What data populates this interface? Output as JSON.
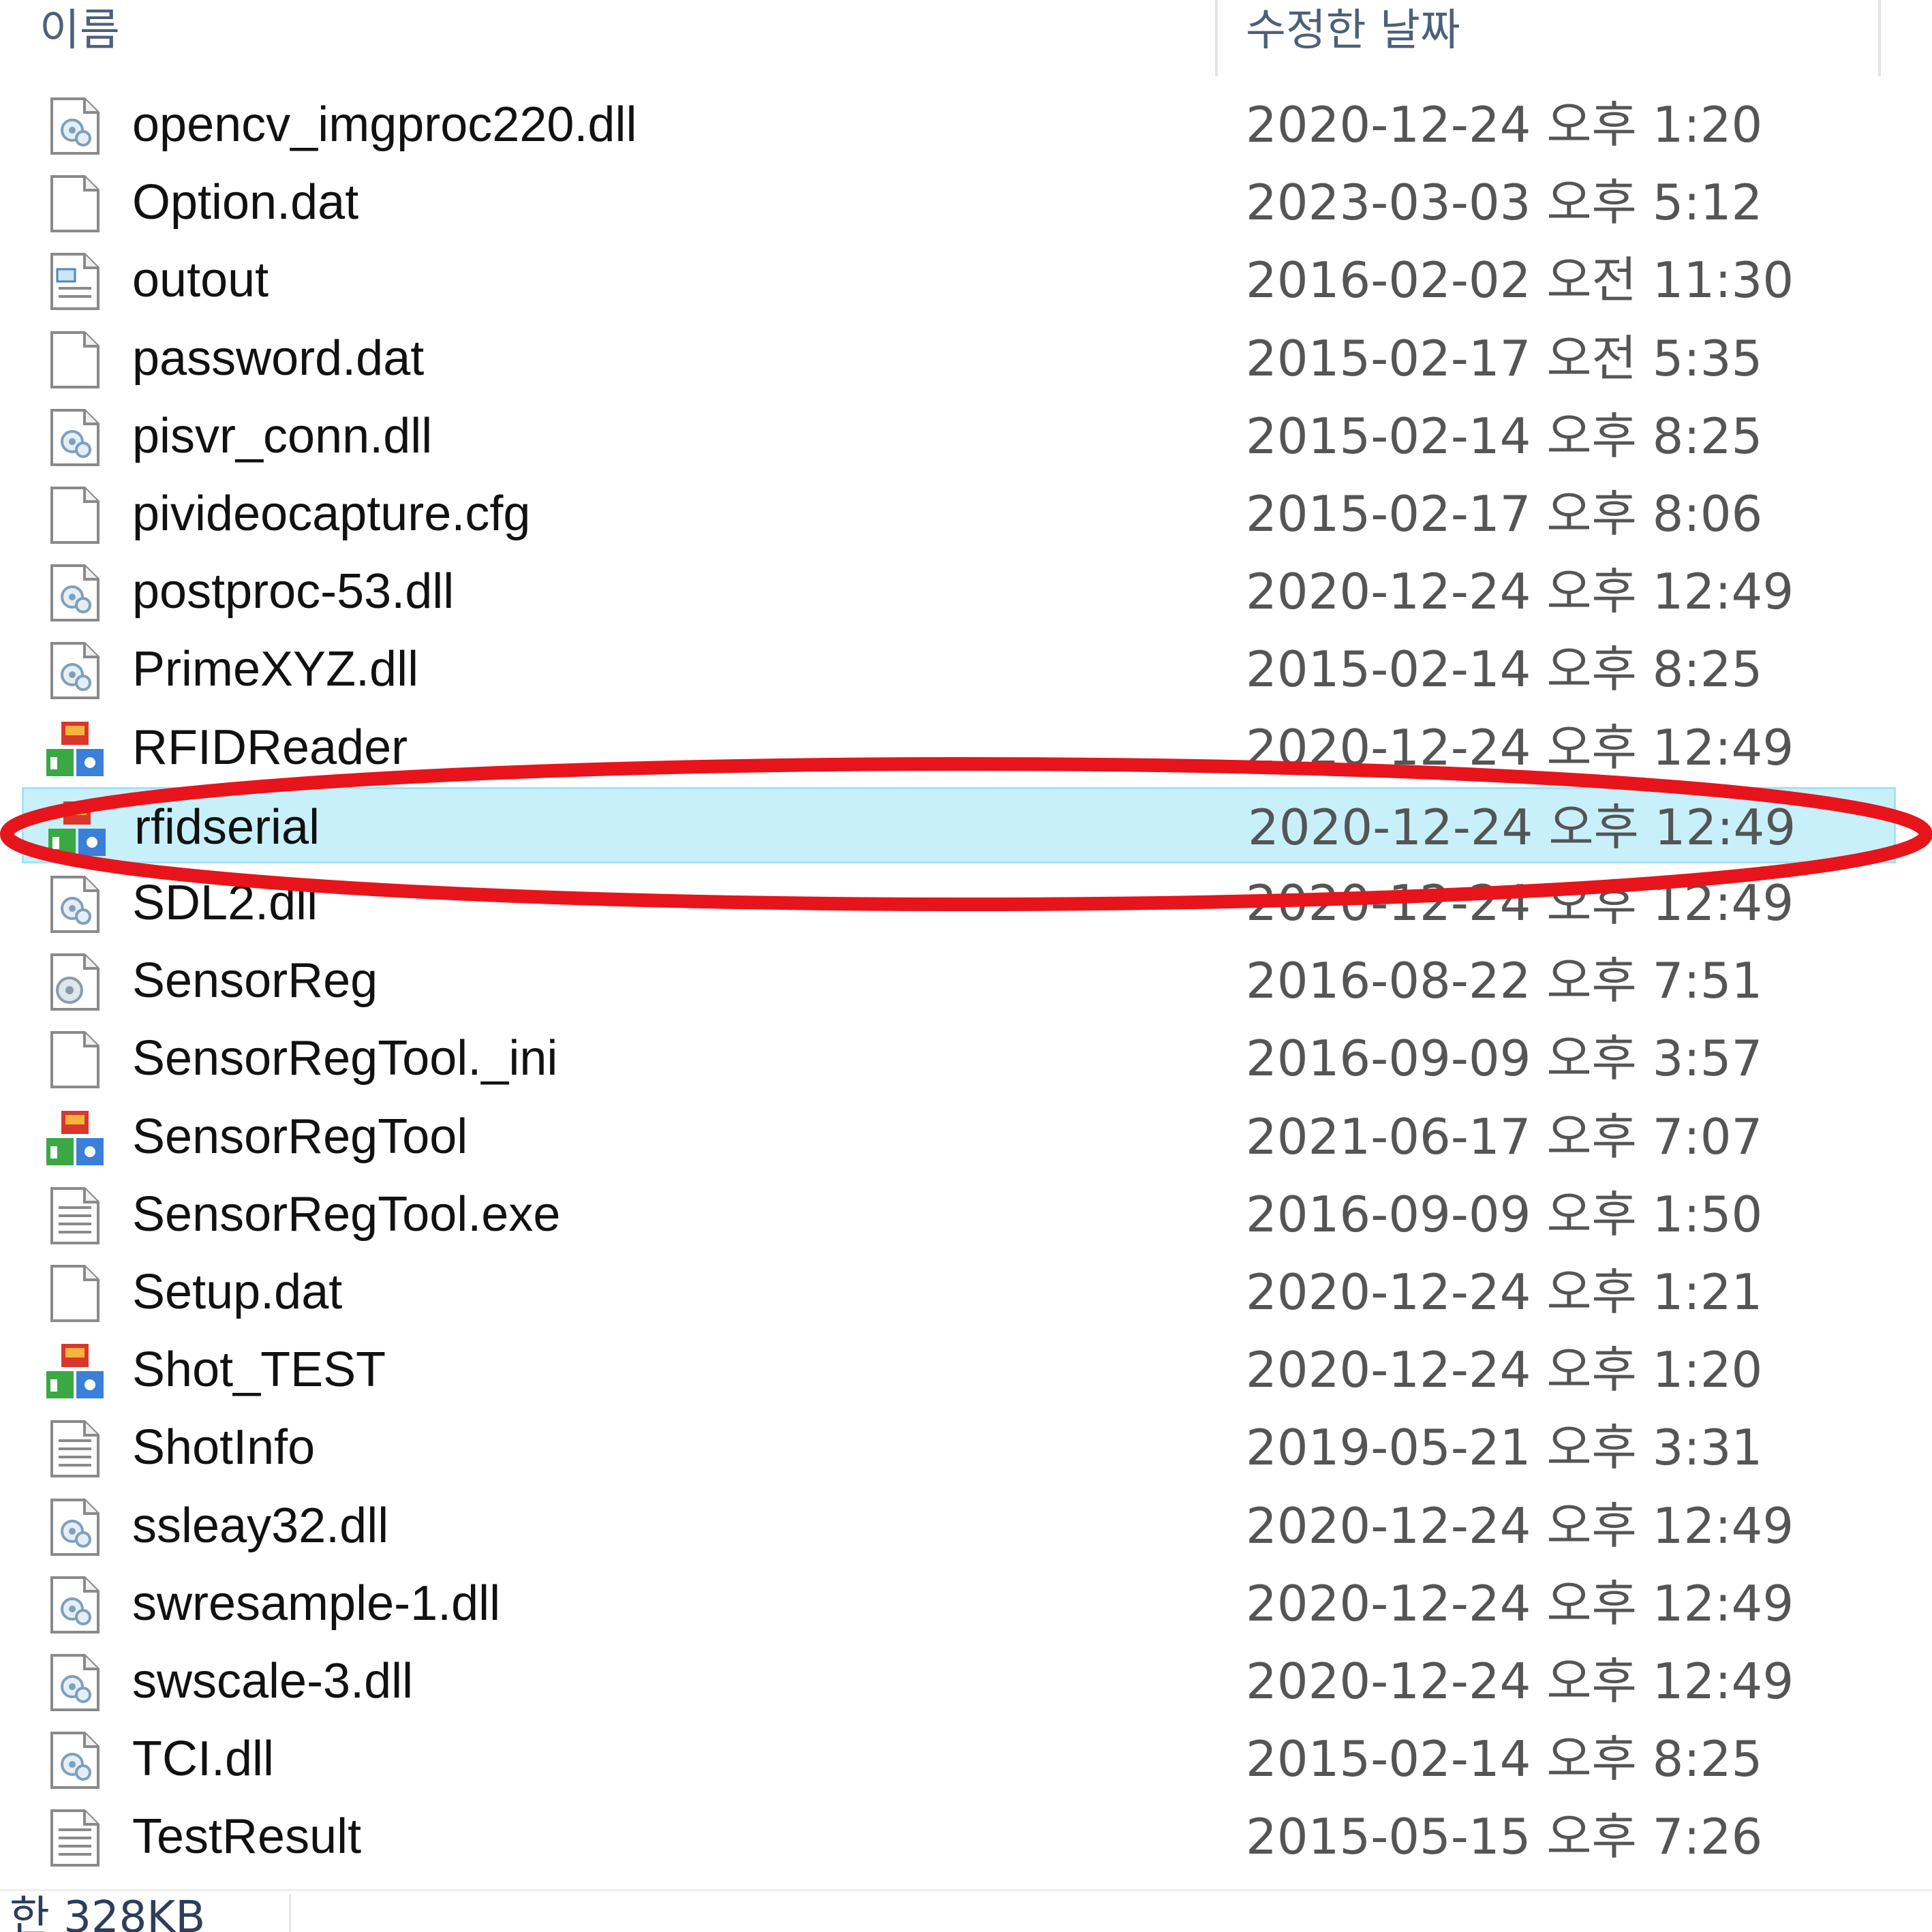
{
  "header": {
    "name_label": "이름",
    "date_label": "수정한 날짜"
  },
  "files": [
    {
      "name": "opencv_imgproc220.dll",
      "date": "2020-12-24 오후 1:20",
      "icon": "dll-file-icon"
    },
    {
      "name": "Option.dat",
      "date": "2023-03-03 오후 5:12",
      "icon": "blank-file-icon"
    },
    {
      "name": "outout",
      "date": "2016-02-02 오전 11:30",
      "icon": "registry-file-icon"
    },
    {
      "name": "password.dat",
      "date": "2015-02-17 오전 5:35",
      "icon": "blank-file-icon"
    },
    {
      "name": "pisvr_conn.dll",
      "date": "2015-02-14 오후 8:25",
      "icon": "dll-file-icon"
    },
    {
      "name": "pivideocapture.cfg",
      "date": "2015-02-17 오후 8:06",
      "icon": "blank-file-icon"
    },
    {
      "name": "postproc-53.dll",
      "date": "2020-12-24 오후 12:49",
      "icon": "dll-file-icon"
    },
    {
      "name": "PrimeXYZ.dll",
      "date": "2015-02-14 오후 8:25",
      "icon": "dll-file-icon"
    },
    {
      "name": "RFIDReader",
      "date": "2020-12-24 오후 12:49",
      "icon": "application-icon"
    },
    {
      "name": "rfidserial",
      "date": "2020-12-24 오후 12:49",
      "icon": "application-icon"
    },
    {
      "name": "SDL2.dll",
      "date": "2020-12-24 오후 12:49",
      "icon": "dll-file-icon"
    },
    {
      "name": "SensorReg",
      "date": "2016-08-22 오후 7:51",
      "icon": "config-file-icon"
    },
    {
      "name": "SensorRegTool._ini",
      "date": "2016-09-09 오후 3:57",
      "icon": "blank-file-icon"
    },
    {
      "name": "SensorRegTool",
      "date": "2021-06-17 오후 7:07",
      "icon": "application-icon"
    },
    {
      "name": "SensorRegTool.exe",
      "date": "2016-09-09 오후 1:50",
      "icon": "text-file-icon"
    },
    {
      "name": "Setup.dat",
      "date": "2020-12-24 오후 1:21",
      "icon": "blank-file-icon"
    },
    {
      "name": "Shot_TEST",
      "date": "2020-12-24 오후 1:20",
      "icon": "application-icon"
    },
    {
      "name": "ShotInfo",
      "date": "2019-05-21 오후 3:31",
      "icon": "text-file-icon"
    },
    {
      "name": "ssleay32.dll",
      "date": "2020-12-24 오후 12:49",
      "icon": "dll-file-icon"
    },
    {
      "name": "swresample-1.dll",
      "date": "2020-12-24 오후 12:49",
      "icon": "dll-file-icon"
    },
    {
      "name": "swscale-3.dll",
      "date": "2020-12-24 오후 12:49",
      "icon": "dll-file-icon"
    },
    {
      "name": "TCI.dll",
      "date": "2015-02-14 오후 8:25",
      "icon": "dll-file-icon"
    },
    {
      "name": "TestResult",
      "date": "2015-05-15 오후 7:26",
      "icon": "text-file-icon"
    }
  ],
  "selected_file": "rfidserial",
  "footer": {
    "size_text": "한 328KB"
  },
  "colors": {
    "selection_fill": "#c8f0fb",
    "selection_border": "#9fe4f7",
    "annotation_red": "#e8141c",
    "header_text": "#4c607a"
  }
}
